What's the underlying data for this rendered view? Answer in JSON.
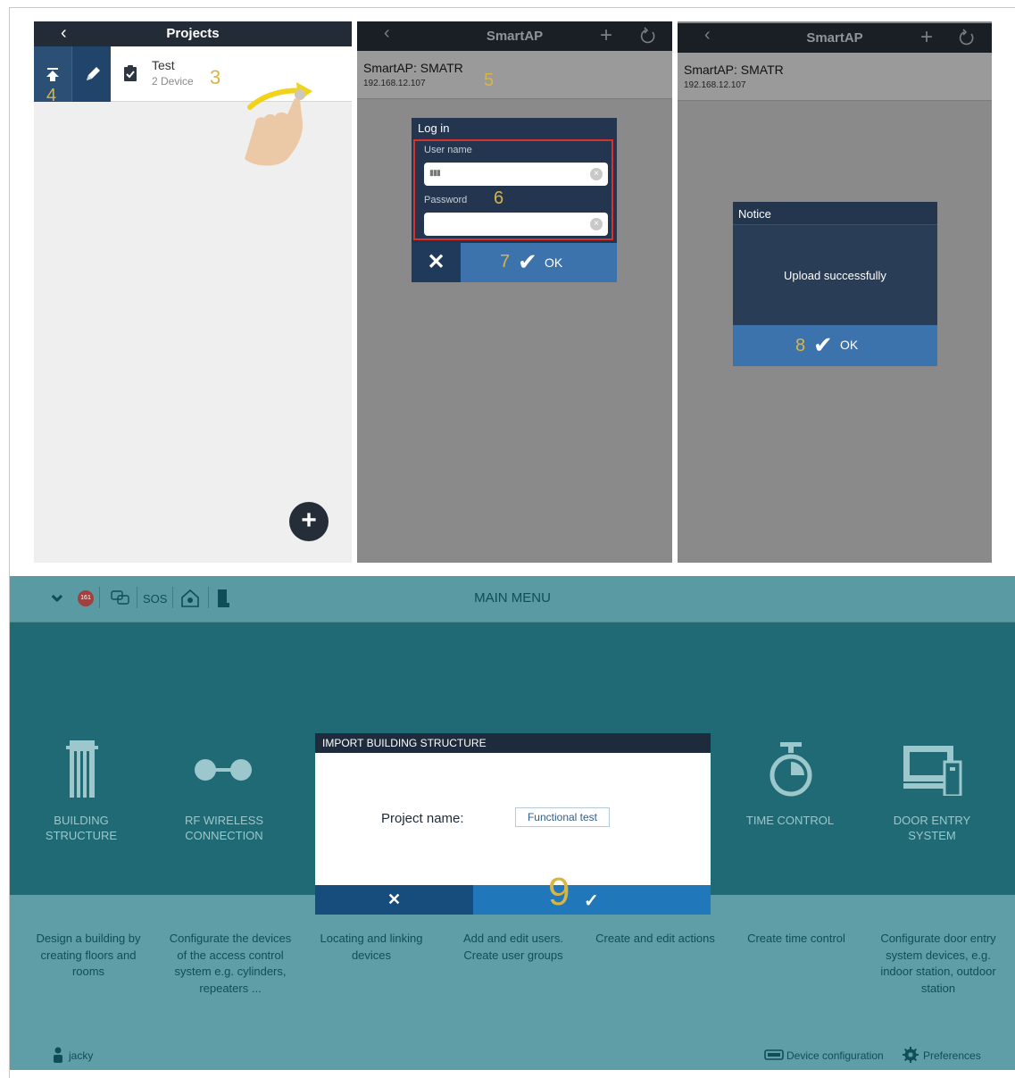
{
  "phone1": {
    "back_glyph": "‹",
    "title": "Projects",
    "project": {
      "name": "Test",
      "devices": "2 Device"
    },
    "callout_row": "3",
    "callout_upload": "4",
    "add_glyph": "+"
  },
  "phone2": {
    "back_glyph": "‹",
    "title": "SmartAP",
    "plus_glyph": "+",
    "device": {
      "title": "SmartAP: SMATR",
      "ip": "192.168.12.107"
    },
    "callout_device": "5",
    "login": {
      "title": "Log in",
      "username_label": "User name",
      "username_value": "▮▮▮",
      "password_label": "Password",
      "callout_fields": "6",
      "cancel_glyph": "✕",
      "callout_ok": "7",
      "ok_check": "✔",
      "ok_label": "OK"
    }
  },
  "phone3": {
    "back_glyph": "‹",
    "title": "SmartAP",
    "plus_glyph": "+",
    "device": {
      "title": "SmartAP: SMATR",
      "ip": "192.168.12.107"
    },
    "notice": {
      "title": "Notice",
      "message": "Upload successfully",
      "callout_ok": "8",
      "ok_check": "✔",
      "ok_label": "OK"
    }
  },
  "main_menu": {
    "title": "MAIN MENU",
    "toolbar": {
      "chevron": "⌄",
      "badge": "161",
      "sos": "SOS"
    },
    "tiles": [
      {
        "label_1": "BUILDING STRUCTURE",
        "label_2": "",
        "description": [
          "Design a building by",
          "creating floors and",
          "rooms",
          ""
        ]
      },
      {
        "label_1": "RF WIRELESS",
        "label_2": "CONNECTION",
        "description": [
          "Configurate the devices",
          "of the access control",
          "system e.g. cylinders,",
          "repeaters ..."
        ]
      },
      {
        "description": [
          "Locating and linking",
          "devices"
        ]
      },
      {
        "description": [
          "Add and edit users.",
          "Create user groups"
        ]
      },
      {
        "description": [
          "Create and edit actions"
        ]
      },
      {
        "label_1": "TIME CONTROL",
        "description": [
          "Create time control"
        ]
      },
      {
        "label_1": "DOOR ENTRY SYSTEM",
        "description": [
          "Configurate door entry",
          "system devices, e.g.",
          "indoor station, outdoor",
          "station"
        ]
      }
    ],
    "modal": {
      "title": "IMPORT BUILDING STRUCTURE",
      "project_label": "Project name:",
      "project_value": "Functional test",
      "cancel_glyph": "✕",
      "callout_ok": "9",
      "ok_check": "✓"
    },
    "footer": {
      "user": "jacky",
      "device_config": "Device configuration",
      "preferences": "Preferences"
    }
  },
  "colors": {
    "callout": "#d8b445",
    "dark_bar": "#232c36",
    "accent_blue": "#3d73ad",
    "teal_dark": "#1f6a74",
    "teal_light": "#5f9ea6"
  }
}
